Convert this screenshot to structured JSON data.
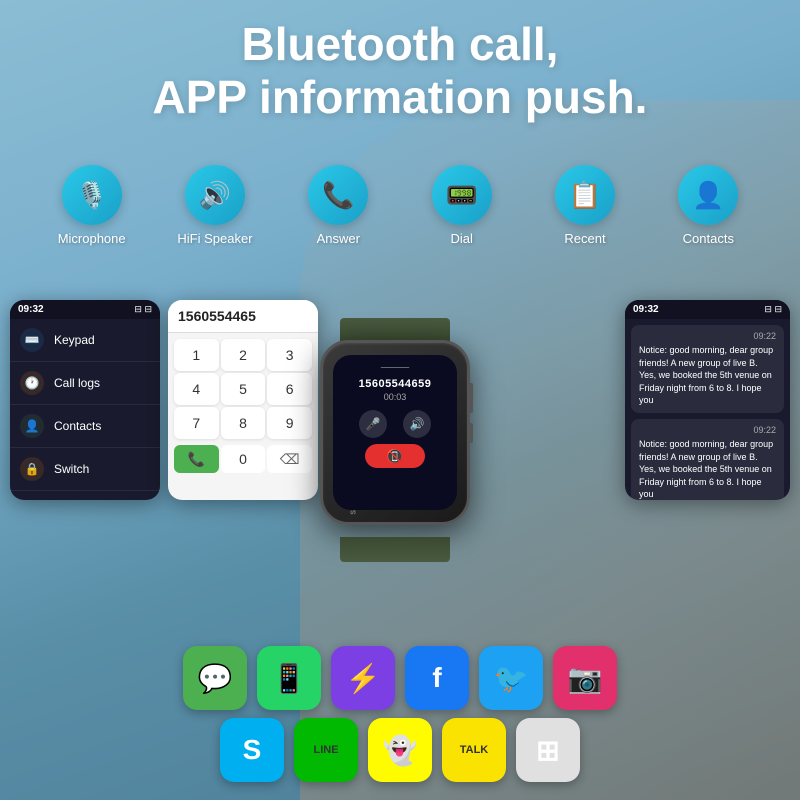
{
  "hero": {
    "line1": "Bluetooth call,",
    "line2": "APP information push."
  },
  "features": [
    {
      "id": "microphone",
      "label": "Microphone",
      "icon": "🎙️",
      "color": "#1ab8e0"
    },
    {
      "id": "hifi-speaker",
      "label": "HiFi Speaker",
      "icon": "🔊",
      "color": "#1ab8e0"
    },
    {
      "id": "answer",
      "label": "Answer",
      "icon": "📞",
      "color": "#1ab8e0"
    },
    {
      "id": "dial",
      "label": "Dial",
      "icon": "📟",
      "color": "#1ab8e0"
    },
    {
      "id": "recent",
      "label": "Recent",
      "icon": "📋",
      "color": "#1ab8e0"
    },
    {
      "id": "contacts",
      "label": "Contacts",
      "icon": "👤",
      "color": "#1ab8e0"
    }
  ],
  "watch_screen": {
    "phone_number": "15605544659",
    "duration": "00:03",
    "mute_icon": "🎤",
    "volume_icon": "🔊",
    "end_icon": "📵"
  },
  "left_panel": {
    "time": "09:32",
    "battery": "⊟",
    "menu_items": [
      {
        "label": "Keypad",
        "icon": "⌨️",
        "color": "#2196F3"
      },
      {
        "label": "Call logs",
        "icon": "🕐",
        "color": "#ff9800"
      },
      {
        "label": "Contacts",
        "icon": "👤",
        "color": "#4CAF50"
      },
      {
        "label": "Switch",
        "icon": "🔒",
        "color": "#ff9800"
      }
    ]
  },
  "keypad_panel": {
    "number": "1560554465",
    "keys": [
      "1",
      "2",
      "3",
      "4",
      "5",
      "6",
      "7",
      "8",
      "9"
    ],
    "bottom_keys": [
      "call",
      "0",
      "del"
    ]
  },
  "notification_panel": {
    "time": "09:32",
    "battery": "⊟",
    "notifications": [
      {
        "time": "09:22",
        "text": "Notice: good morning, dear group friends! A new group of live B. Yes, we booked the 5th venue on Friday night from 6 to 8. I hope you"
      },
      {
        "time": "09:22",
        "text": "Notice: good morning, dear group friends! A new group of live B. Yes, we booked the 5th venue on Friday night from 6 to 8. I hope you"
      }
    ]
  },
  "apps_row1": [
    {
      "id": "messages",
      "bg": "#4CAF50",
      "icon": "💬"
    },
    {
      "id": "whatsapp",
      "bg": "#25D366",
      "icon": "📱"
    },
    {
      "id": "messenger",
      "bg": "linear-gradient(135deg,#833ab4,#fd1d1d,#fcb045)",
      "icon": "⚡"
    },
    {
      "id": "facebook",
      "bg": "#1877F2",
      "icon": "𝒻"
    },
    {
      "id": "twitter",
      "bg": "#1DA1F2",
      "icon": "🐦"
    },
    {
      "id": "instagram",
      "bg": "#E1306C",
      "icon": "📸"
    }
  ],
  "apps_row2": [
    {
      "id": "skype",
      "bg": "#00AFF0",
      "icon": "𝒮"
    },
    {
      "id": "line",
      "bg": "#00B900",
      "icon": "LINE"
    },
    {
      "id": "snapchat",
      "bg": "#FFFC00",
      "icon": "👻"
    },
    {
      "id": "kakaotalk",
      "bg": "#FAE300",
      "icon": "TALK"
    },
    {
      "id": "grid-app",
      "bg": "#ffffff",
      "icon": "⊞"
    }
  ]
}
